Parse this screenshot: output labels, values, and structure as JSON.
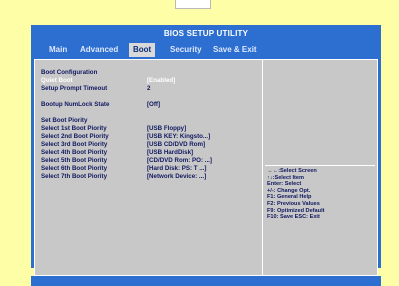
{
  "header": {
    "title": "BIOS SETUP UTILITY"
  },
  "tabs": [
    {
      "label": "Main"
    },
    {
      "label": "Advanced"
    },
    {
      "label": "Boot"
    },
    {
      "label": "Security"
    },
    {
      "label": "Save & Exit"
    }
  ],
  "active_tab": "Boot",
  "left_panel": {
    "section_boot_config": "Boot Configuration",
    "quiet_boot": {
      "label": "Quiet Boot",
      "value": "[Enabled]"
    },
    "setup_prompt_timeout": {
      "label": "Setup Prompt Timeout",
      "value": "2"
    },
    "numlock": {
      "label": "Bootup NumLock State",
      "value": "[Off]"
    },
    "section_priority": "Set Boot Piority",
    "boot_items": [
      {
        "label": "Select 1st Boot Piority",
        "value": "[USB Floppy]"
      },
      {
        "label": "Select 2nd Boot Piority",
        "value": "[USB KEY: Kingsto...]"
      },
      {
        "label": "Select 3rd Boot Piority",
        "value": "[USB CD/DVD Rom]"
      },
      {
        "label": "Select 4th Boot Piority",
        "value": "[USB HardDisk]"
      },
      {
        "label": "Select 5th Boot Piority",
        "value": "[CD/DVD Rom: PO: ...]"
      },
      {
        "label": "Select 6th Boot Piority",
        "value": "[Hard Disk: PS: T ...]"
      },
      {
        "label": "Select 7th Boot Piority",
        "value": "[Network Device: ...]"
      }
    ]
  },
  "right_panel": {
    "help_lines": [
      "→←:Select Screen",
      "↑↓:Select Item",
      "Enter: Select",
      "+/-: Change Opt.",
      "F1: General Help",
      "F2: Previous Values",
      "F9: Optimized Default",
      "F10: Save   ESC: Exit"
    ]
  },
  "colors": {
    "bios_blue": "#2c6fd0",
    "panel_gray": "#c8c8c8",
    "text_navy": "#101860",
    "background_yellow": "#fefea6"
  }
}
